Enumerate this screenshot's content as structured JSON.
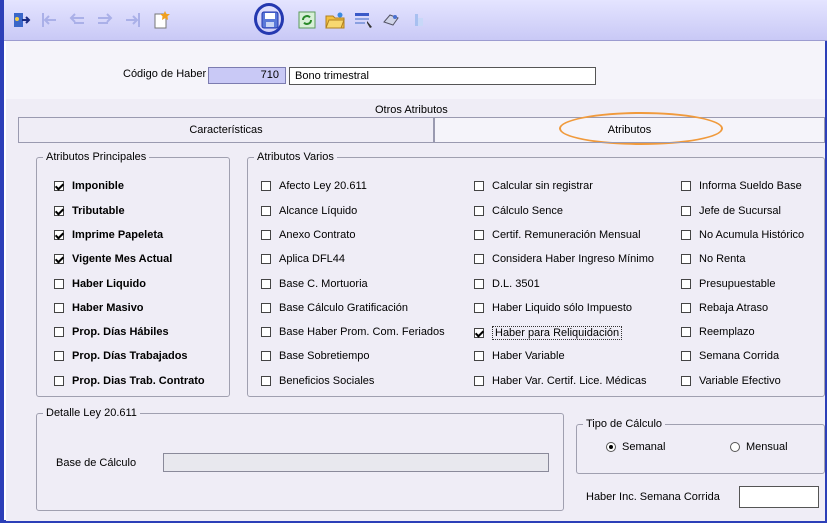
{
  "toolbar": {
    "icons": [
      "exit-icon",
      "first-record-icon",
      "prev-record-icon",
      "next-record-icon",
      "last-record-icon",
      "new-record-icon",
      "save-icon",
      "refresh-icon",
      "open-folder-icon",
      "filter-icon",
      "print-icon",
      "help-icon"
    ]
  },
  "header": {
    "codigo_label": "Código de Haber",
    "codigo_value": "710",
    "descripcion_value": "Bono trimestral",
    "otros_atributos": "Otros Atributos"
  },
  "tabs": [
    {
      "label": "Características"
    },
    {
      "label": "Atributos"
    }
  ],
  "principales": {
    "legend": "Atributos Principales",
    "items": [
      {
        "label": "Imponible",
        "checked": true
      },
      {
        "label": "Tributable",
        "checked": true
      },
      {
        "label": "Imprime Papeleta",
        "checked": true
      },
      {
        "label": "Vigente Mes Actual",
        "checked": true
      },
      {
        "label": "Haber Liquido",
        "checked": false
      },
      {
        "label": "Haber Masivo",
        "checked": false
      },
      {
        "label": "Prop. Días Hábiles",
        "checked": false
      },
      {
        "label": "Prop. Días Trabajados",
        "checked": false
      },
      {
        "label": "Prop. Dias Trab. Contrato",
        "checked": false
      }
    ]
  },
  "varios": {
    "legend": "Atributos Varios",
    "col1": [
      {
        "label": "Afecto Ley 20.611",
        "checked": false
      },
      {
        "label": "Alcance Líquido",
        "checked": false
      },
      {
        "label": "Anexo Contrato",
        "checked": false
      },
      {
        "label": "Aplica DFL44",
        "checked": false
      },
      {
        "label": "Base C. Mortuoria",
        "checked": false
      },
      {
        "label": "Base Cálculo Gratificación",
        "checked": false
      },
      {
        "label": "Base Haber Prom. Com. Feriados",
        "checked": false
      },
      {
        "label": "Base Sobretiempo",
        "checked": false
      },
      {
        "label": "Beneficios Sociales",
        "checked": false
      }
    ],
    "col2": [
      {
        "label": "Calcular sin registrar",
        "checked": false
      },
      {
        "label": "Cálculo Sence",
        "checked": false
      },
      {
        "label": "Certif. Remuneración Mensual",
        "checked": false
      },
      {
        "label": "Considera Haber Ingreso Mínimo",
        "checked": false
      },
      {
        "label": "D.L. 3501",
        "checked": false
      },
      {
        "label": "Haber Liquido sólo Impuesto",
        "checked": false
      },
      {
        "label": "Haber para Reliquidación",
        "checked": true
      },
      {
        "label": "Haber Variable",
        "checked": false
      },
      {
        "label": "Haber Var. Certif. Lice. Médicas",
        "checked": false
      }
    ],
    "col3": [
      {
        "label": "Informa Sueldo Base",
        "checked": false
      },
      {
        "label": "Jefe de Sucursal",
        "checked": false
      },
      {
        "label": "No Acumula Histórico",
        "checked": false
      },
      {
        "label": "No Renta",
        "checked": false
      },
      {
        "label": "Presupuestable",
        "checked": false
      },
      {
        "label": "Rebaja Atraso",
        "checked": false
      },
      {
        "label": "Reemplazo",
        "checked": false
      },
      {
        "label": "Semana Corrida",
        "checked": false
      },
      {
        "label": "Variable Efectivo",
        "checked": false
      }
    ]
  },
  "detalle": {
    "legend": "Detalle Ley 20.611",
    "base_label": "Base de Cálculo",
    "base_value": ""
  },
  "tipo": {
    "legend": "Tipo de Cálculo",
    "semanal": "Semanal",
    "mensual": "Mensual",
    "selected": "Semanal"
  },
  "semana_corrida": {
    "label": "Haber Inc. Semana Corrida",
    "value": ""
  },
  "colors": {
    "frame": "#2c3fb8",
    "toolbar": "#c9c9f6",
    "highlight_ring_save": "#2438b0",
    "highlight_ring_tab": "#f09a3c"
  }
}
